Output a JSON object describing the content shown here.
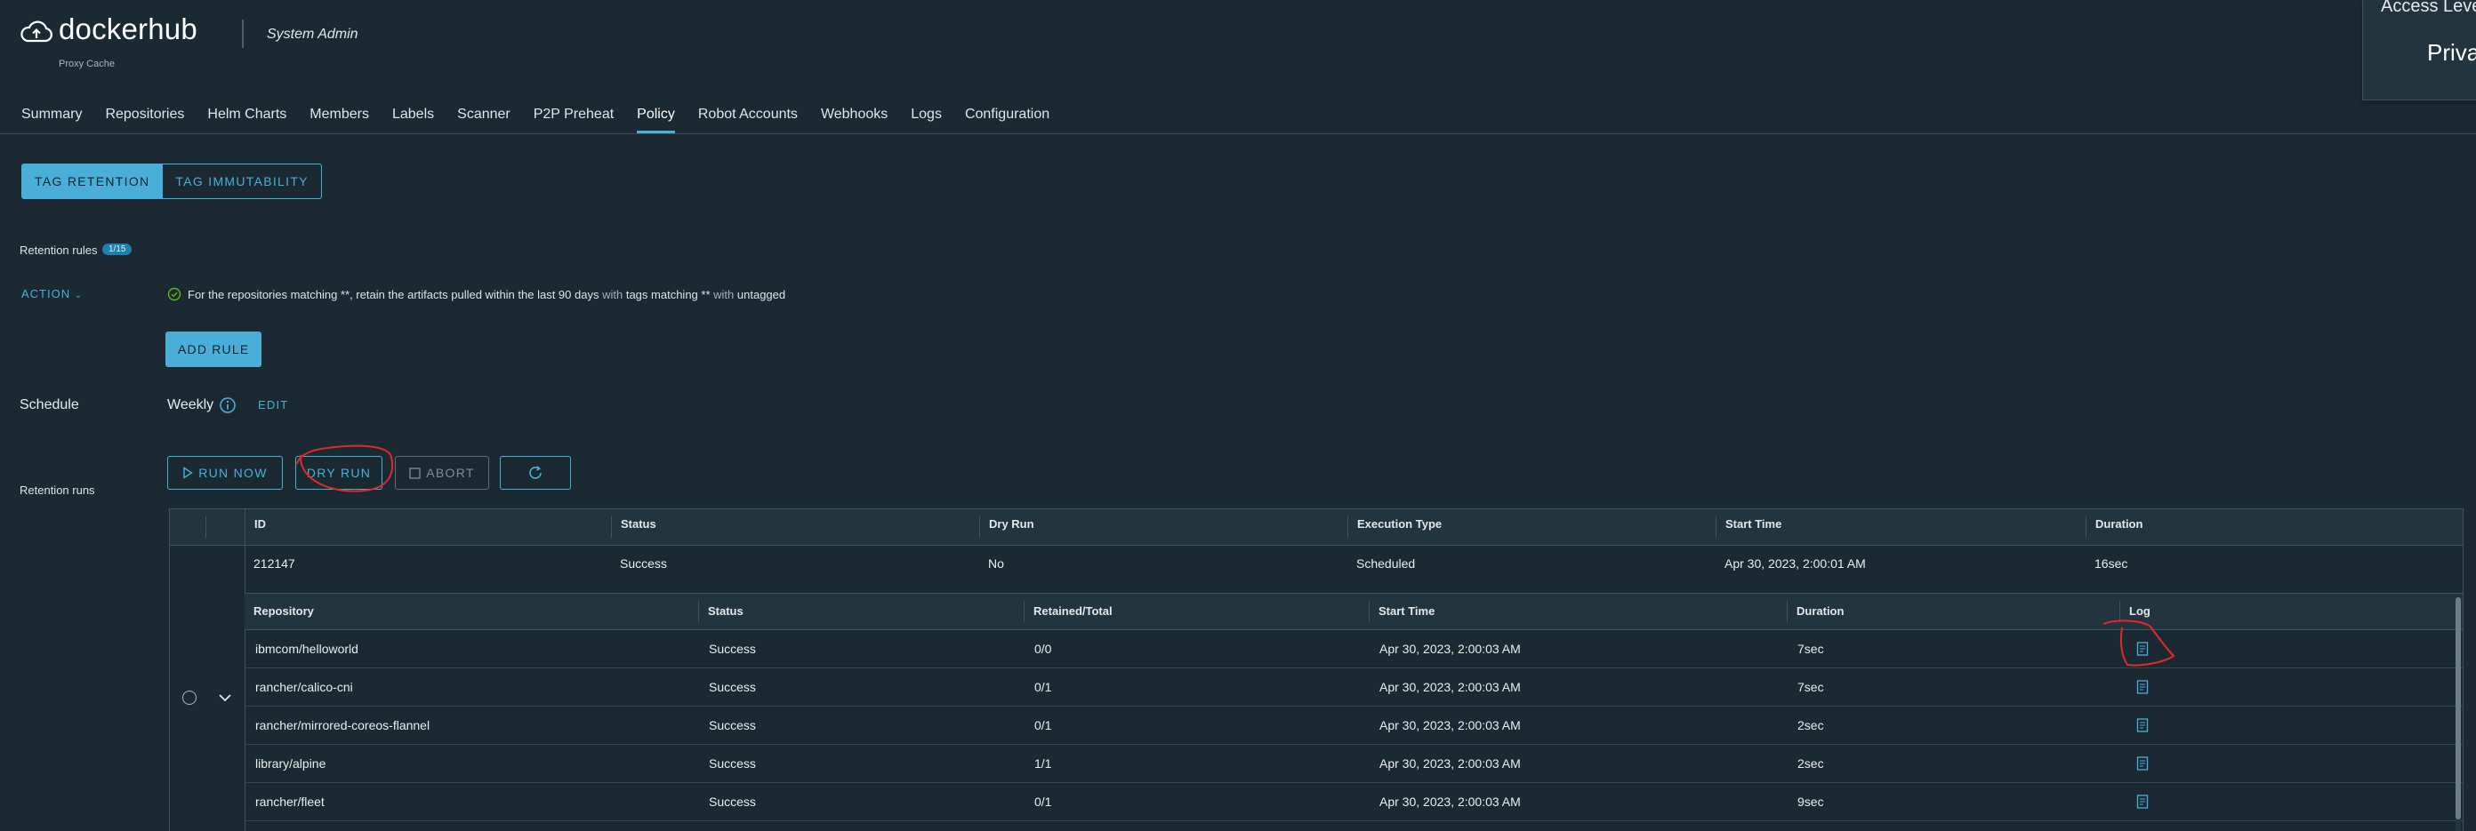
{
  "header": {
    "project_name": "dockerhub",
    "role": "System Admin",
    "subtitle": "Proxy Cache",
    "access_level_label": "Access Level",
    "access_level_value": "Private"
  },
  "nav": {
    "tabs": [
      {
        "label": "Summary"
      },
      {
        "label": "Repositories"
      },
      {
        "label": "Helm Charts"
      },
      {
        "label": "Members"
      },
      {
        "label": "Labels"
      },
      {
        "label": "Scanner"
      },
      {
        "label": "P2P Preheat"
      },
      {
        "label": "Policy",
        "active": true
      },
      {
        "label": "Robot Accounts"
      },
      {
        "label": "Webhooks"
      },
      {
        "label": "Logs"
      },
      {
        "label": "Configuration"
      }
    ]
  },
  "policy_tabs": {
    "tag_retention": "TAG RETENTION",
    "tag_immutability": "TAG IMMUTABILITY"
  },
  "retention": {
    "rules_label": "Retention rules",
    "rules_count": "1/15",
    "action_label": "ACTION",
    "rule": {
      "part1": "For the repositories matching **, retain the artifacts pulled within the last 90 days",
      "with1": "with",
      "part2": "tags matching **",
      "with2": "with",
      "part3": "untagged"
    },
    "add_rule_label": "ADD RULE",
    "schedule_label": "Schedule",
    "schedule_value": "Weekly",
    "edit_label": "EDIT",
    "runs_label": "Retention runs",
    "run_now_label": "RUN NOW",
    "dry_run_label": "DRY RUN",
    "abort_label": "ABORT"
  },
  "runs_table": {
    "columns": [
      "ID",
      "Status",
      "Dry Run",
      "Execution Type",
      "Start Time",
      "Duration"
    ],
    "row": {
      "id": "212147",
      "status": "Success",
      "dry_run": "No",
      "execution_type": "Scheduled",
      "start_time": "Apr 30, 2023, 2:00:01 AM",
      "duration": "16sec"
    }
  },
  "tasks_table": {
    "columns": [
      "Repository",
      "Status",
      "Retained/Total",
      "Start Time",
      "Duration",
      "Log"
    ],
    "rows": [
      {
        "repository": "ibmcom/helloworld",
        "status": "Success",
        "retained": "0/0",
        "start_time": "Apr 30, 2023, 2:00:03 AM",
        "duration": "7sec"
      },
      {
        "repository": "rancher/calico-cni",
        "status": "Success",
        "retained": "0/1",
        "start_time": "Apr 30, 2023, 2:00:03 AM",
        "duration": "7sec"
      },
      {
        "repository": "rancher/mirrored-coreos-flannel",
        "status": "Success",
        "retained": "0/1",
        "start_time": "Apr 30, 2023, 2:00:03 AM",
        "duration": "2sec"
      },
      {
        "repository": "library/alpine",
        "status": "Success",
        "retained": "1/1",
        "start_time": "Apr 30, 2023, 2:00:03 AM",
        "duration": "2sec"
      },
      {
        "repository": "rancher/fleet",
        "status": "Success",
        "retained": "0/1",
        "start_time": "Apr 30, 2023, 2:00:03 AM",
        "duration": "9sec"
      }
    ]
  },
  "colors": {
    "accent": "#49afd9",
    "background": "#1b2a32",
    "annotation": "#e0282d"
  }
}
